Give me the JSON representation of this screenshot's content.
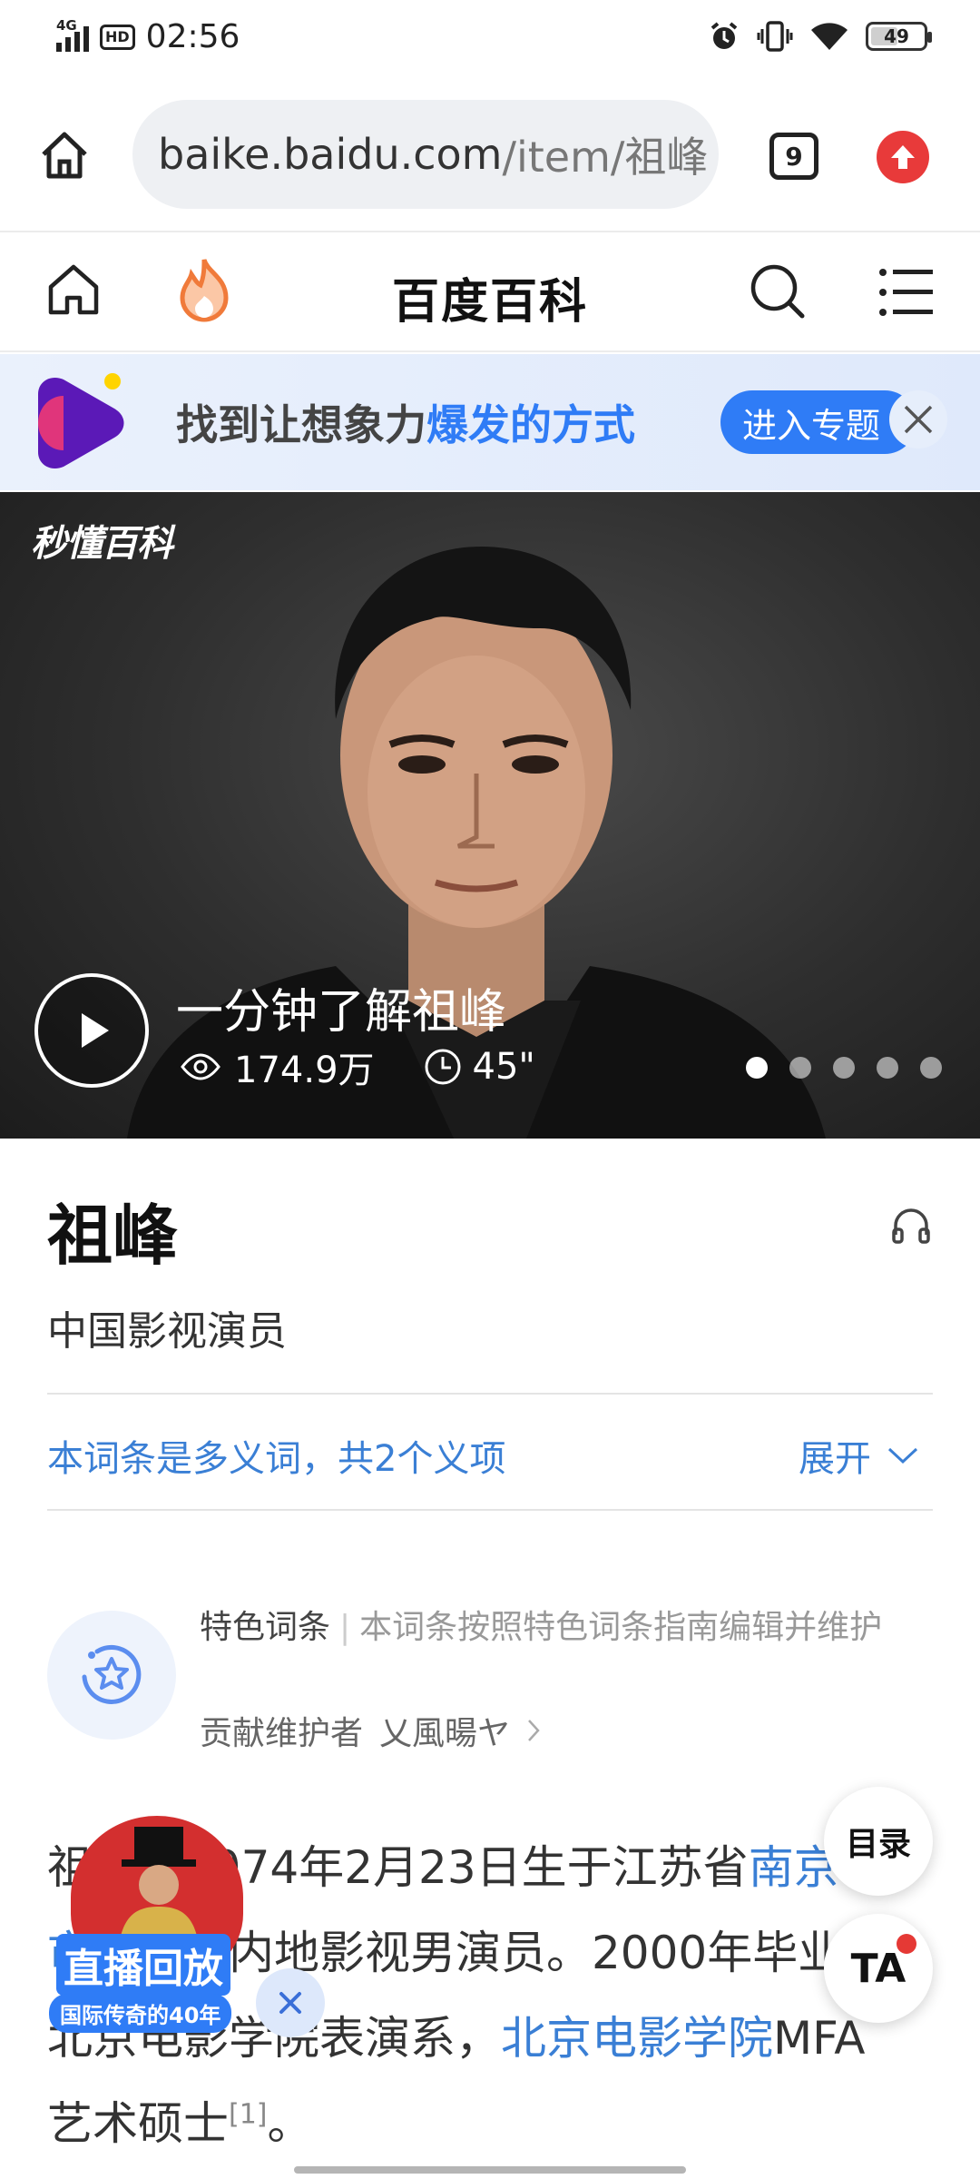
{
  "status_bar": {
    "network": "4G",
    "hd": "HD",
    "time": "02:56",
    "battery": "49"
  },
  "browser": {
    "url_host": "baike.baidu.com",
    "url_path": "/item/祖峰",
    "tab_count": "9"
  },
  "header": {
    "title": "百度百科"
  },
  "banner": {
    "text_plain": "找到让想象力",
    "text_highlight": "爆发的方式",
    "button": "进入专题"
  },
  "video": {
    "brand": "秒懂百科",
    "title": "一分钟了解祖峰",
    "views": "174.9万",
    "duration": "45\"",
    "slide_count": 5,
    "active_slide": 1
  },
  "entry": {
    "title": "祖峰",
    "subtitle": "中国影视演员",
    "polysemy": "本词条是多义词，共2个义项",
    "expand": "展开"
  },
  "featured": {
    "label": "特色词条",
    "desc": "本词条按照特色词条指南编辑并维护",
    "maintainer_label": "贡献维护者",
    "maintainer": "乂風暘ヤ"
  },
  "intro": {
    "seg1": "祖峰，1974年2月23日生于江苏省",
    "link1": "南京市",
    "seg2": "，中国内地影视男演员。2000年毕业于北京电影学院表演系，",
    "link2": "北京电影学院",
    "seg3": "MFA艺术硕士",
    "ref": "[1]",
    "seg4": "。"
  },
  "floating": {
    "toc": "目录",
    "ta": "TA"
  },
  "live_promo": {
    "label": "直播回放",
    "sub": "国际传奇的40年"
  },
  "colors": {
    "accent": "#2f7cf6",
    "link": "#3a7fd5",
    "live_red": "#d32f2f"
  }
}
